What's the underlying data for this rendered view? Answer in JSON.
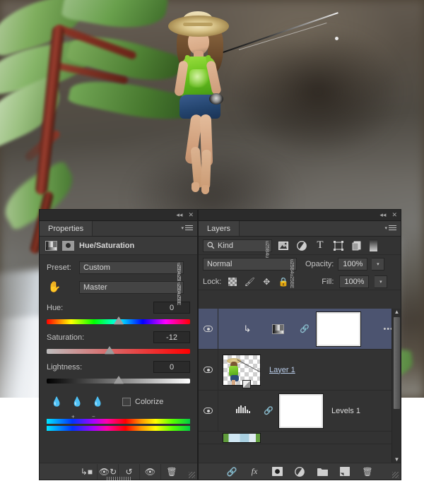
{
  "app": "Adobe Photoshop",
  "properties_panel": {
    "tab_label": "Properties",
    "collapse_icon": "◂◂",
    "close_icon": "✕",
    "menu_icon": "panel-menu-icon",
    "adjustment_title": "Hue/Saturation",
    "preset_label": "Preset:",
    "preset_value": "Custom",
    "channel_value": "Master",
    "targeted_adjust_icon": "hand-icon",
    "sliders": [
      {
        "label": "Hue:",
        "value": "0",
        "knob_percent": 50,
        "track": "hue"
      },
      {
        "label": "Saturation:",
        "value": "-12",
        "knob_percent": 44,
        "track": "sat"
      },
      {
        "label": "Lightness:",
        "value": "0",
        "knob_percent": 50,
        "track": "light"
      }
    ],
    "eyedroppers": [
      "eyedropper-icon",
      "eyedropper-add-icon",
      "eyedropper-subtract-icon"
    ],
    "colorize_label": "Colorize",
    "colorize_checked": false,
    "footer_buttons": [
      "clip-to-layer-button",
      "toggle-previous-state-button",
      "reset-button",
      "toggle-visibility-button",
      "delete-adjustment-button"
    ]
  },
  "layers_panel": {
    "tab_label": "Layers",
    "collapse_icon": "◂◂",
    "close_icon": "✕",
    "filter_label": "Kind",
    "filter_icons": [
      "filter-pixel-icon",
      "filter-adjustment-icon",
      "filter-type-icon",
      "filter-shape-icon",
      "filter-smart-object-icon",
      "filter-toggle-switch"
    ],
    "blend_mode": "Normal",
    "opacity_label": "Opacity:",
    "opacity_value": "100%",
    "lock_label": "Lock:",
    "lock_icons": [
      "lock-transparent-pixels-icon",
      "lock-image-pixels-icon",
      "lock-position-icon",
      "lock-all-icon"
    ],
    "fill_label": "Fill:",
    "fill_value": "100%",
    "layers": [
      {
        "name": "",
        "selected": true,
        "visible": true,
        "type": "adjustment",
        "clipped": true,
        "has_mask": true,
        "overflow_icon": "•••"
      },
      {
        "name": "Layer 1",
        "selected": false,
        "visible": true,
        "type": "pixel",
        "clipped": false,
        "has_mask": false,
        "linked_style": true
      },
      {
        "name": "Levels 1",
        "selected": false,
        "visible": true,
        "type": "levels",
        "clipped": false,
        "has_mask": true
      },
      {
        "name": "",
        "selected": false,
        "visible": true,
        "type": "background",
        "partial": true
      }
    ],
    "footer_buttons": [
      "link-layers-button",
      "layer-styles-button",
      "add-layer-mask-button",
      "new-adjustment-layer-button",
      "new-group-button",
      "new-layer-button",
      "delete-layer-button"
    ]
  },
  "colors": {
    "panel_bg": "#333333",
    "panel_header": "#3a3a3a",
    "selection": "#4c5470",
    "text": "#d6d6d6",
    "link_text": "#b8cbe8"
  }
}
